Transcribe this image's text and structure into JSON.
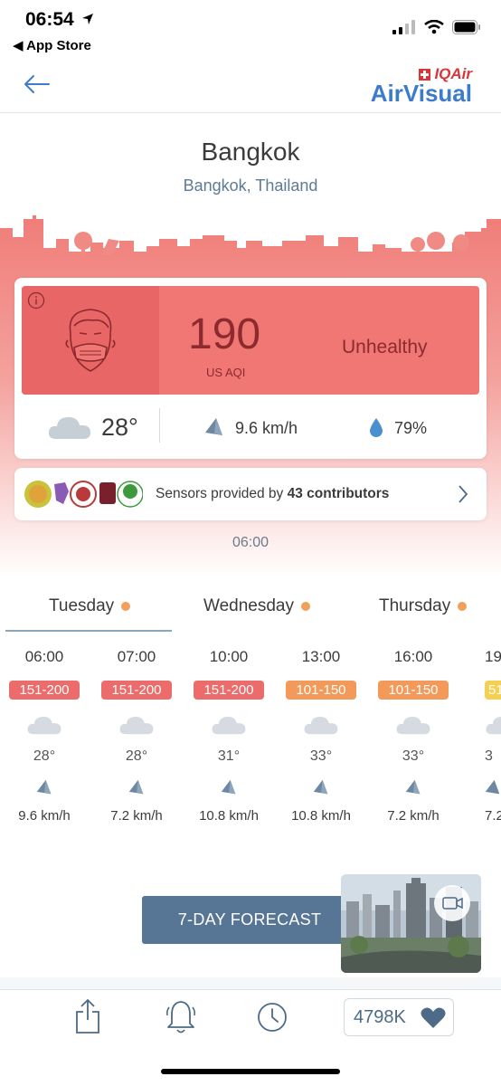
{
  "status_bar": {
    "time": "06:54",
    "back_label": "◀ App Store"
  },
  "header": {
    "brand_top": "IQAir",
    "brand_bottom": "AirVisual"
  },
  "location": {
    "city": "Bangkok",
    "region": "Bangkok, Thailand"
  },
  "aqi": {
    "value": "190",
    "unit": "US AQI",
    "status": "Unhealthy",
    "temperature": "28°",
    "wind": "9.6 km/h",
    "humidity": "79%",
    "color": "#f07773"
  },
  "contributors": {
    "prefix": "Sensors provided by ",
    "count_text": "43 contributors"
  },
  "updated_time": "06:00",
  "tabs": [
    {
      "label": "Tuesday"
    },
    {
      "label": "Wednesday"
    },
    {
      "label": "Thursday"
    }
  ],
  "hourly": [
    {
      "time": "06:00",
      "aqi": "151-200",
      "color": "#ec6b6b",
      "temp": "28°",
      "wind": "9.6 km/h"
    },
    {
      "time": "07:00",
      "aqi": "151-200",
      "color": "#ec6b6b",
      "temp": "28°",
      "wind": "7.2 km/h"
    },
    {
      "time": "10:00",
      "aqi": "151-200",
      "color": "#ec6b6b",
      "temp": "31°",
      "wind": "10.8 km/h"
    },
    {
      "time": "13:00",
      "aqi": "101-150",
      "color": "#f39a5a",
      "temp": "33°",
      "wind": "10.8 km/h"
    },
    {
      "time": "16:00",
      "aqi": "101-150",
      "color": "#f39a5a",
      "temp": "33°",
      "wind": "7.2 km/h"
    },
    {
      "time": "19",
      "aqi": "51",
      "color": "#f4cf52",
      "temp": "3",
      "wind": "7.2"
    }
  ],
  "forecast_button": "7-DAY FORECAST",
  "toolbar": {
    "likes": "4798K"
  },
  "colors": {
    "accent": "#3d7cc9",
    "button": "#577695",
    "unhealthy": "#f07773",
    "sensitive": "#f39a5a",
    "moderate": "#f4cf52"
  },
  "icons": [
    "location-arrow-icon",
    "signal-icon",
    "wifi-icon",
    "battery-icon",
    "back-arrow-icon",
    "info-icon",
    "face-mask-icon",
    "cloud-icon",
    "wind-icon",
    "droplet-icon",
    "chevron-right-icon",
    "video-icon",
    "share-icon",
    "bell-icon",
    "clock-icon",
    "heart-icon"
  ]
}
